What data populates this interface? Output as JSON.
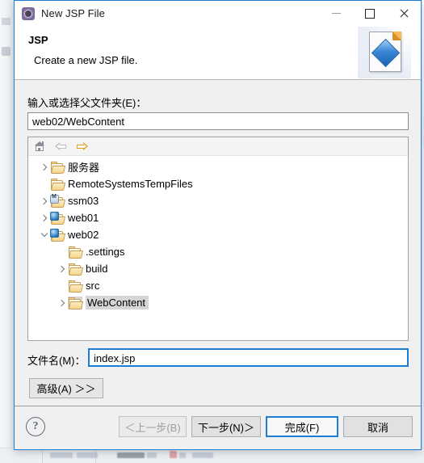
{
  "window": {
    "title": "New JSP File",
    "icon": "eclipse-gear-icon",
    "minimize_label": "—",
    "maximize_label": "□",
    "close_label": "✕"
  },
  "banner": {
    "title": "JSP",
    "description": "Create a new JSP file.",
    "icon": "jsp-file-icon"
  },
  "parent_folder": {
    "label": "输入或选择父文件夹(E)：",
    "value": "web02/WebContent"
  },
  "tree_toolbar": {
    "home": "home-icon",
    "back": "back-arrow-icon",
    "forward": "forward-arrow-icon"
  },
  "tree": {
    "nodes": [
      {
        "label": "服务器",
        "icon": "folder",
        "indent": 0,
        "twisty": "collapsed",
        "selected": false
      },
      {
        "label": "RemoteSystemsTempFiles",
        "icon": "folder",
        "indent": 0,
        "twisty": "none",
        "selected": false
      },
      {
        "label": "ssm03",
        "icon": "project-maven",
        "indent": 0,
        "twisty": "collapsed",
        "selected": false
      },
      {
        "label": "web01",
        "icon": "project-web",
        "indent": 0,
        "twisty": "collapsed",
        "selected": false
      },
      {
        "label": "web02",
        "icon": "project-web",
        "indent": 0,
        "twisty": "expanded",
        "selected": false
      },
      {
        "label": ".settings",
        "icon": "folder",
        "indent": 1,
        "twisty": "none",
        "selected": false
      },
      {
        "label": "build",
        "icon": "folder",
        "indent": 1,
        "twisty": "collapsed",
        "selected": false
      },
      {
        "label": "src",
        "icon": "folder",
        "indent": 1,
        "twisty": "none",
        "selected": false
      },
      {
        "label": "WebContent",
        "icon": "folder",
        "indent": 1,
        "twisty": "collapsed",
        "selected": true
      }
    ]
  },
  "file_name": {
    "label": "文件名(M)：",
    "value": "index.jsp"
  },
  "advanced_button": "高级(A) ＞＞",
  "footer": {
    "help": "?",
    "back": "＜上一步(B)",
    "next": "下一步(N)＞",
    "finish": "完成(F)",
    "cancel": "取消"
  },
  "colors": {
    "accent": "#1a7fd4",
    "dialog_bg": "#f0f0f0",
    "selection": "#d6d6d6"
  }
}
